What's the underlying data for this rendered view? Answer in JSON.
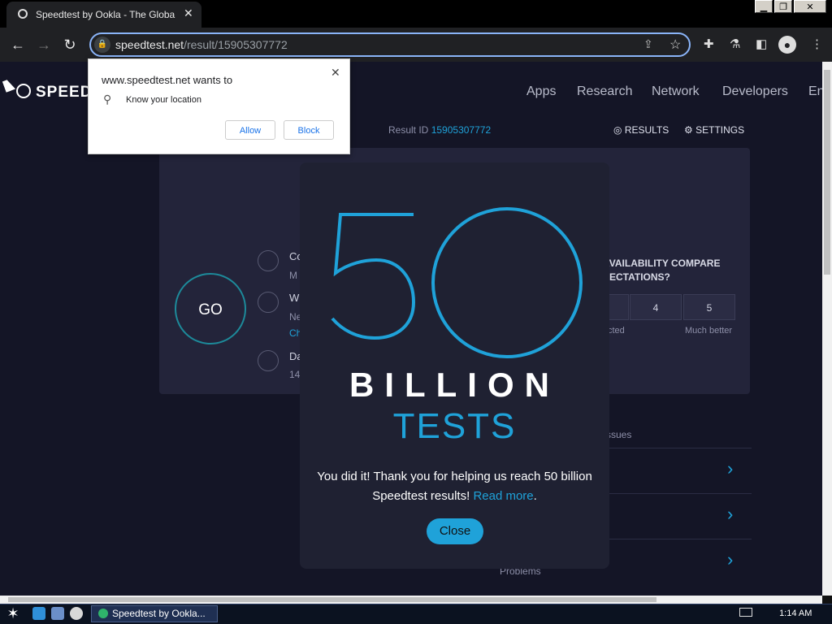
{
  "browser": {
    "tab_title": "Speedtest by Ookla - The Global Broadband Speed Test",
    "url_host": "speedtest.net",
    "url_path": "/result/15905307772",
    "window_controls": [
      "minimize",
      "restore",
      "close"
    ]
  },
  "permission_prompt": {
    "heading": "www.speedtest.net wants to",
    "item": "Know your location",
    "allow": "Allow",
    "block": "Block"
  },
  "site": {
    "logo": "SPEEDT",
    "nav": [
      "Apps",
      "Research",
      "Network",
      "Developers",
      "En"
    ],
    "result_id_label": "Result ID",
    "result_id": "15905307772",
    "results_label": "RESULTS",
    "settings_label": "SETTINGS",
    "go": "GO",
    "bg_rows": [
      "Co",
      "M",
      "W",
      "Ne",
      "Ch",
      "Da",
      "14"
    ],
    "rating_question": "AVAILABILITY COMPARE PECTATIONS?",
    "rating_values": [
      "4",
      "5"
    ],
    "rating_left_caption": "cted",
    "rating_right_caption": "Much better",
    "issues_label": "ssues",
    "problems_label": "Problems"
  },
  "modal": {
    "big_number": "50",
    "line1": "BILLION",
    "line2": "TESTS",
    "message_part1": "You did it! Thank you for helping us reach 50 billion Speedtest results!",
    "read_more": "Read more",
    "message_end": ".",
    "close": "Close"
  },
  "taskbar": {
    "item": "Speedtest by Ookla...",
    "time": "1:14 AM"
  },
  "colors": {
    "accent": "#1fa2d9",
    "page_bg": "#141526",
    "modal_bg": "#1f2132"
  }
}
